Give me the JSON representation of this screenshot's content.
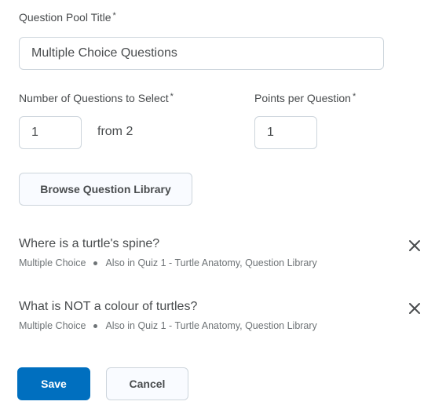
{
  "form": {
    "title_field": {
      "label": "Question Pool Title",
      "required_marker": "*",
      "value": "Multiple Choice Questions"
    },
    "num_questions_field": {
      "label": "Number of Questions to Select",
      "required_marker": "*",
      "value": "1",
      "suffix": "from 2"
    },
    "points_field": {
      "label": "Points per Question",
      "required_marker": "*",
      "value": "1"
    },
    "browse_button": "Browse Question Library"
  },
  "questions": [
    {
      "title": "Where is a turtle's spine?",
      "type": "Multiple Choice",
      "also_in": "Also in Quiz 1 - Turtle Anatomy, Question Library",
      "remove_icon": "close-icon"
    },
    {
      "title": "What is NOT a colour of turtles?",
      "type": "Multiple Choice",
      "also_in": "Also in Quiz 1 - Turtle Anatomy, Question Library",
      "remove_icon": "close-icon"
    }
  ],
  "actions": {
    "save": "Save",
    "cancel": "Cancel"
  },
  "colors": {
    "primary": "#006fbf",
    "text": "#494c4e",
    "border": "#cdd5dc"
  }
}
